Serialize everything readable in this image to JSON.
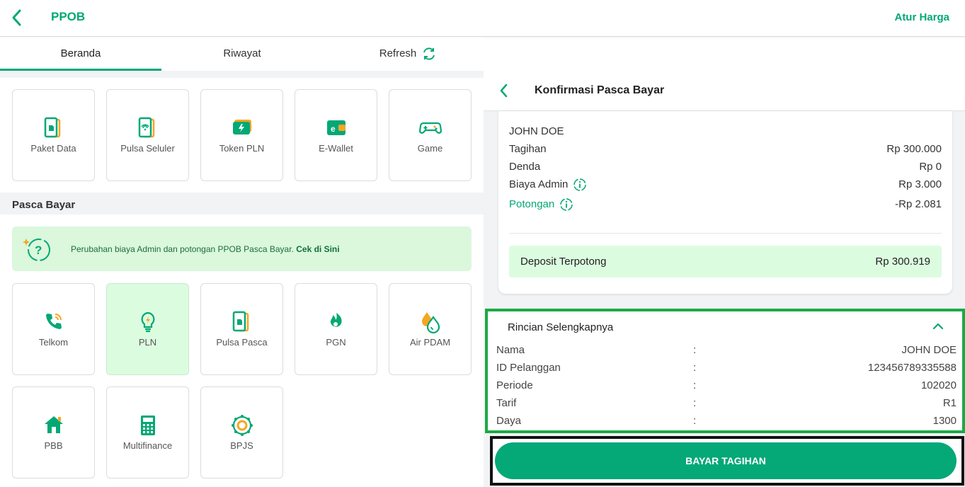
{
  "header": {
    "title": "PPOB",
    "action": "Atur Harga"
  },
  "tabs": [
    {
      "label": "Beranda"
    },
    {
      "label": "Riwayat"
    },
    {
      "label": "Refresh"
    }
  ],
  "prabayar": {
    "items": [
      {
        "label": "Paket Data",
        "icon": "phone-sim-icon"
      },
      {
        "label": "Pulsa Seluler",
        "icon": "phone-signal-icon"
      },
      {
        "label": "Token PLN",
        "icon": "token-icon"
      },
      {
        "label": "E-Wallet",
        "icon": "wallet-icon"
      },
      {
        "label": "Game",
        "icon": "gamepad-icon"
      }
    ]
  },
  "pasca": {
    "title": "Pasca Bayar",
    "banner_text": "Perubahan biaya Admin dan potongan PPOB Pasca Bayar.",
    "banner_link": "Cek di Sini",
    "items": [
      {
        "label": "Telkom",
        "icon": "telephone-icon"
      },
      {
        "label": "PLN",
        "icon": "lightbulb-icon"
      },
      {
        "label": "Pulsa Pasca",
        "icon": "phone-sim-icon"
      },
      {
        "label": "PGN",
        "icon": "gas-icon"
      },
      {
        "label": "Air PDAM",
        "icon": "water-drop-icon"
      },
      {
        "label": "PBB",
        "icon": "house-icon"
      },
      {
        "label": "Multifinance",
        "icon": "calculator-icon"
      },
      {
        "label": "BPJS",
        "icon": "bpjs-icon"
      }
    ]
  },
  "confirm": {
    "title": "Konfirmasi Pasca Bayar",
    "customer": "JOHN DOE",
    "rows": [
      {
        "label": "Tagihan",
        "value": "Rp 300.000"
      },
      {
        "label": "Denda",
        "value": "Rp 0"
      },
      {
        "label": "Biaya Admin",
        "value": "Rp 3.000"
      },
      {
        "label": "Potongan",
        "value": "-Rp 2.081"
      }
    ],
    "deposit_label": "Deposit Terpotong",
    "deposit_value": "Rp 300.919"
  },
  "rincian": {
    "title": "Rincian Selengkapnya",
    "rows": [
      {
        "label": "Nama",
        "sep": ":",
        "value": "JOHN DOE"
      },
      {
        "label": "ID Pelanggan",
        "sep": ":",
        "value": "123456789335588"
      },
      {
        "label": "Periode",
        "sep": ":",
        "value": "102020"
      },
      {
        "label": "Tarif",
        "sep": ":",
        "value": "R1"
      },
      {
        "label": "Daya",
        "sep": ":",
        "value": "1300"
      }
    ]
  },
  "pay_button": "BAYAR TAGIHAN",
  "colors": {
    "primary": "#03a875",
    "selected_bg": "#dcfce0",
    "highlight_border": "#1aaa45",
    "accent_orange": "#f5a623"
  }
}
